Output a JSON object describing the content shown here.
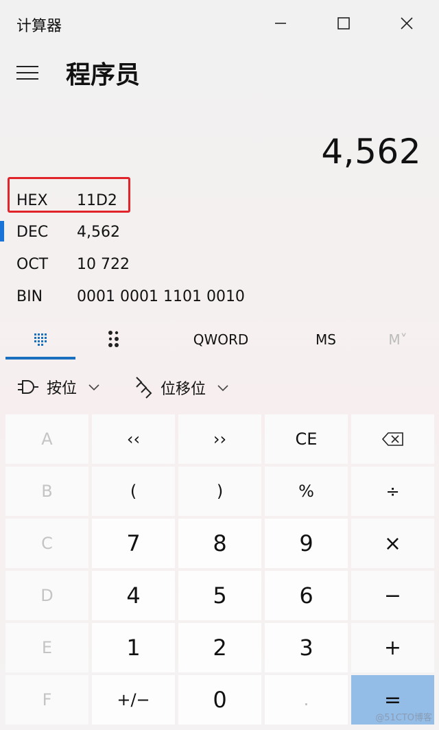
{
  "window": {
    "title": "计算器"
  },
  "header": {
    "mode_title": "程序员"
  },
  "display": {
    "value": "4,562"
  },
  "radix": [
    {
      "label": "HEX",
      "value": "11D2",
      "highlighted": true
    },
    {
      "label": "DEC",
      "value": "4,562",
      "selected": true
    },
    {
      "label": "OCT",
      "value": "10 722"
    },
    {
      "label": "BIN",
      "value": "0001 0001 1101 0010"
    }
  ],
  "modebar": {
    "keypad_icon": "full-keypad-icon",
    "bit_toggle_icon": "bit-toggling-keypad-icon",
    "word_size": "QWORD",
    "memory_store": "MS",
    "memory_view": "M˅"
  },
  "operators": {
    "bitwise_label": "按位",
    "shift_label": "位移位"
  },
  "keys": [
    [
      "A",
      "‹‹",
      "››",
      "CE",
      "backspace-icon"
    ],
    [
      "B",
      "(",
      ")",
      "%",
      "÷"
    ],
    [
      "C",
      "7",
      "8",
      "9",
      "×"
    ],
    [
      "D",
      "4",
      "5",
      "6",
      "−"
    ],
    [
      "E",
      "1",
      "2",
      "3",
      "+"
    ],
    [
      "F",
      "+/−",
      "0",
      ".",
      "="
    ]
  ],
  "key_labels": {
    "lshift": "‹‹",
    "rshift": "››",
    "ce": "CE",
    "lparen": "(",
    "rparen": ")",
    "percent": "%",
    "negate": "+/−",
    "decimal": ".",
    "equals": "="
  },
  "colors": {
    "accent": "#1b6fbf",
    "highlight_border": "#e0242a",
    "equals_bg": "#93bde7"
  },
  "watermark": "@51CTO博客"
}
